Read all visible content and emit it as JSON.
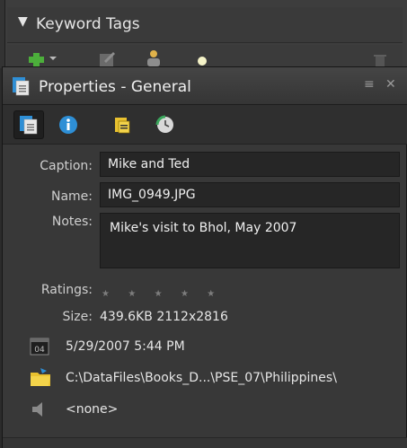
{
  "keyword_panel": {
    "title": "Keyword Tags"
  },
  "properties": {
    "title": "Properties - General",
    "tabs": [
      {
        "name": "general-tab-icon",
        "selected": true
      },
      {
        "name": "metadata-tab-icon",
        "selected": false
      },
      {
        "name": "keywords-tab-icon",
        "selected": false
      },
      {
        "name": "history-tab-icon",
        "selected": false
      }
    ],
    "caption_label": "Caption:",
    "caption_value": "Mike and Ted",
    "name_label": "Name:",
    "name_value": "IMG_0949.JPG",
    "notes_label": "Notes:",
    "notes_value": "Mike's visit to Bhol, May 2007",
    "ratings_label": "Ratings:",
    "ratings_value": 0,
    "ratings_max": 5,
    "size_label": "Size:",
    "size_value": "439.6KB  2112x2816",
    "date_value": "5/29/2007 5:44 PM",
    "path_value": "C:\\DataFiles\\Books_D...\\PSE_07\\Philippines\\",
    "audio_value": "<none>"
  },
  "colors": {
    "panel_bg": "#383838",
    "field_bg": "#262626",
    "accent_blue": "#2e8fd6",
    "folder_yellow": "#e9c12f"
  }
}
